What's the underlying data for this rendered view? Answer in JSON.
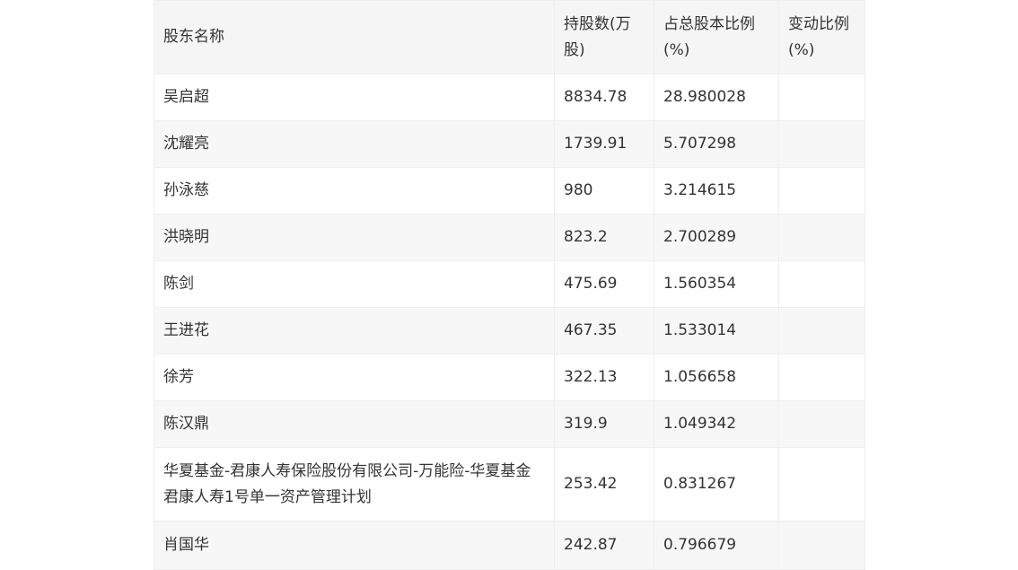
{
  "table": {
    "headers": [
      "股东名称",
      "持股数(万股)",
      "占总股本比例(%)",
      "变动比例(%)"
    ],
    "rows": [
      {
        "name": "吴启超",
        "shares": "8834.78",
        "ratio": "28.980028",
        "change": ""
      },
      {
        "name": "沈耀亮",
        "shares": "1739.91",
        "ratio": "5.707298",
        "change": ""
      },
      {
        "name": "孙泳慈",
        "shares": "980",
        "ratio": "3.214615",
        "change": ""
      },
      {
        "name": "洪晓明",
        "shares": "823.2",
        "ratio": "2.700289",
        "change": ""
      },
      {
        "name": "陈剑",
        "shares": "475.69",
        "ratio": "1.560354",
        "change": ""
      },
      {
        "name": "王进花",
        "shares": "467.35",
        "ratio": "1.533014",
        "change": ""
      },
      {
        "name": "徐芳",
        "shares": "322.13",
        "ratio": "1.056658",
        "change": ""
      },
      {
        "name": "陈汉鼎",
        "shares": "319.9",
        "ratio": "1.049342",
        "change": ""
      },
      {
        "name": "华夏基金-君康人寿保险股份有限公司-万能险-华夏基金君康人寿1号单一资产管理计划",
        "shares": "253.42",
        "ratio": "0.831267",
        "change": ""
      },
      {
        "name": "肖国华",
        "shares": "242.87",
        "ratio": "0.796679",
        "change": ""
      }
    ]
  }
}
